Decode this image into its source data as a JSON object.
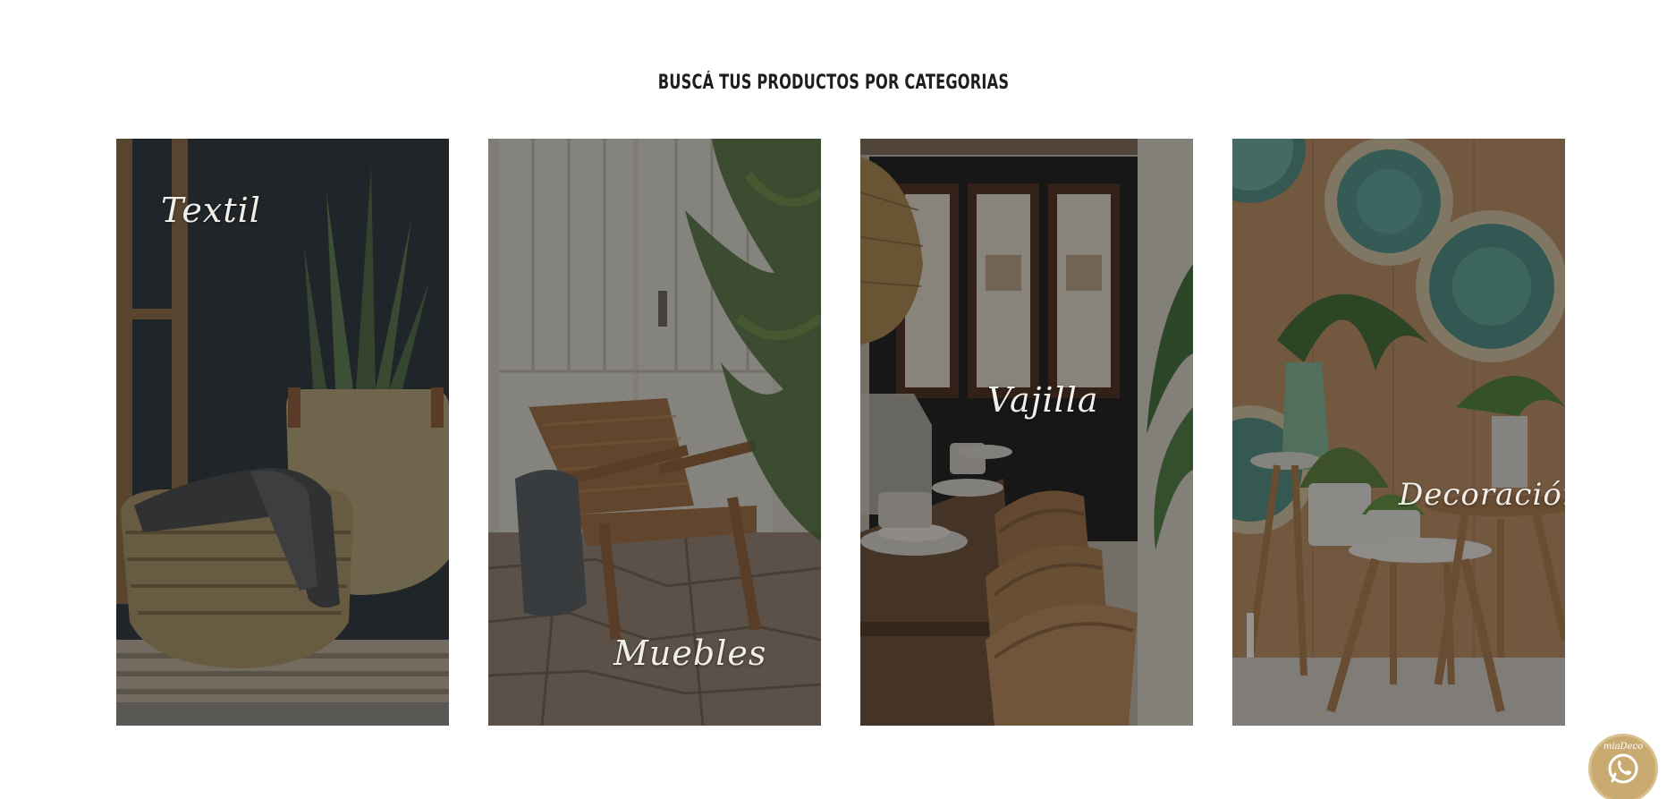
{
  "section": {
    "title": "BUSCÁ TUS PRODUCTOS POR CATEGORIAS"
  },
  "categories": [
    {
      "label": "Textil"
    },
    {
      "label": "Muebles"
    },
    {
      "label": "Vajilla"
    },
    {
      "label": "Decoración"
    }
  ],
  "whatsapp": {
    "brand": "miaDeco"
  },
  "colors": {
    "title_text": "#1e1e1e",
    "label_text": "#f2efe9",
    "whatsapp_badge": "#c9ab72"
  }
}
